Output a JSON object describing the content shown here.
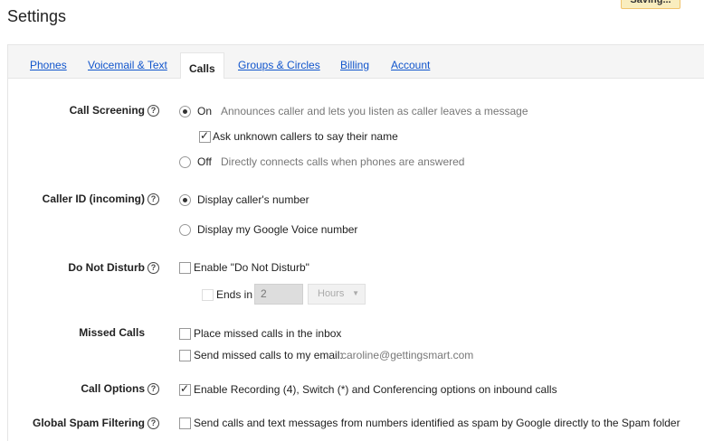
{
  "page": {
    "title": "Settings",
    "saving_badge": "Saving..."
  },
  "tabs": [
    {
      "label": "Phones"
    },
    {
      "label": "Voicemail & Text"
    },
    {
      "label": "Calls"
    },
    {
      "label": "Groups & Circles"
    },
    {
      "label": "Billing"
    },
    {
      "label": "Account"
    }
  ],
  "call_screening": {
    "label": "Call Screening",
    "on_label": "On",
    "on_desc": "Announces caller and lets you listen as caller leaves a message",
    "ask_unknown_label": "Ask unknown callers to say their name",
    "off_label": "Off",
    "off_desc": "Directly connects calls when phones are answered"
  },
  "caller_id": {
    "label": "Caller ID (incoming)",
    "option1": "Display caller's number",
    "option2": "Display my Google Voice number"
  },
  "do_not_disturb": {
    "label": "Do Not Disturb",
    "enable_label": "Enable \"Do Not Disturb\"",
    "ends_in_label": "Ends in",
    "ends_in_value": "2",
    "unit_value": "Hours"
  },
  "missed_calls": {
    "label": "Missed Calls",
    "inbox_label": "Place missed calls in the inbox",
    "email_label": "Send missed calls to my email:",
    "email_value": "caroline@gettingsmart.com"
  },
  "call_options": {
    "label": "Call Options",
    "recording_label": "Enable Recording (4), Switch (*) and Conferencing options on inbound calls"
  },
  "spam": {
    "label": "Global Spam Filtering",
    "send_label": "Send calls and text messages from numbers identified as spam by Google directly to the Spam folder"
  },
  "help_glyph": "?"
}
